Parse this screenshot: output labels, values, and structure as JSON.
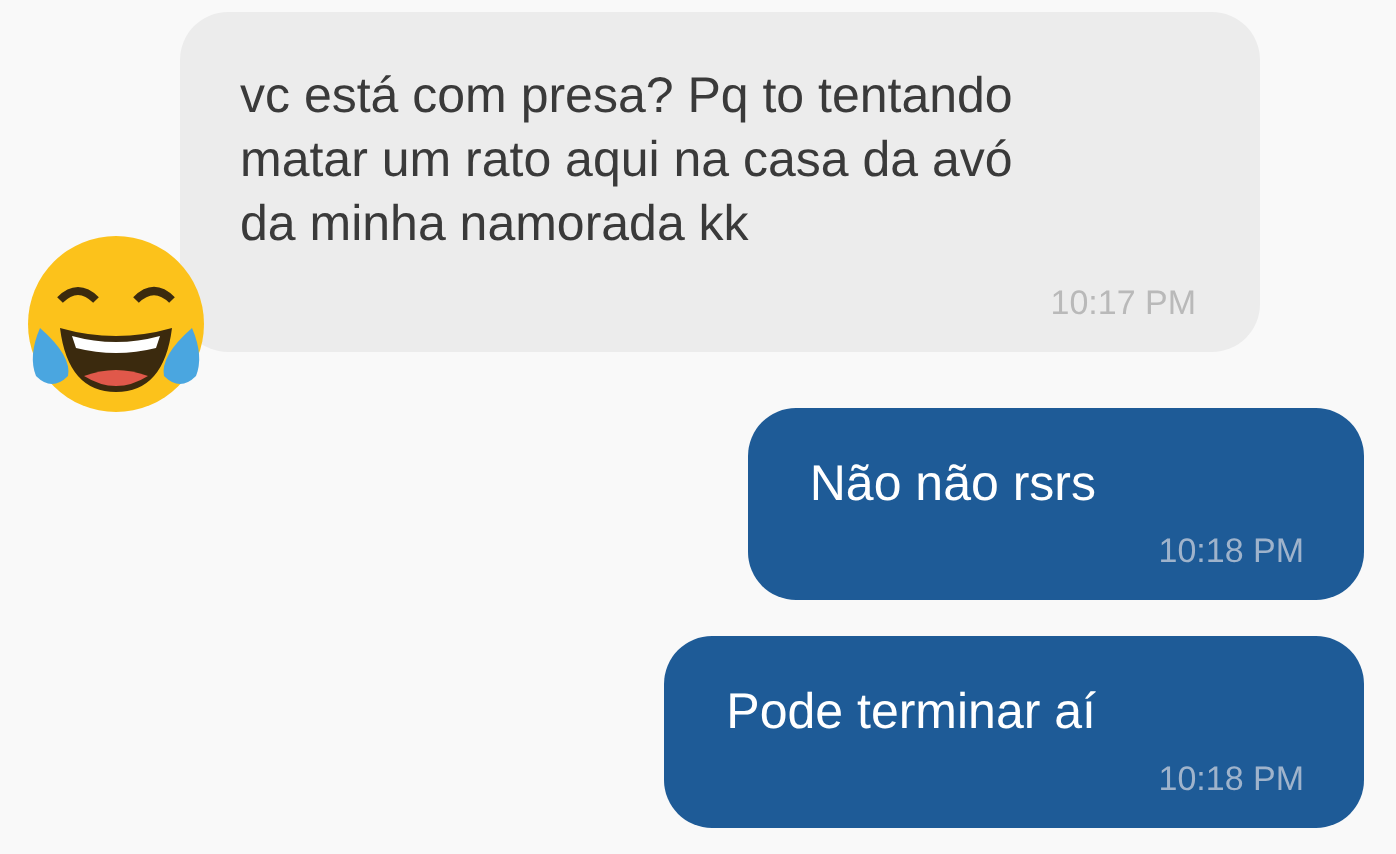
{
  "messages": [
    {
      "kind": "incoming",
      "avatar": true,
      "text": "vc está com presa? Pq to tentando\nmatar um rato aqui na casa da avó\nda minha namorada kk",
      "time": "10:17 PM"
    },
    {
      "kind": "outgoing",
      "avatar": false,
      "text": "Não não rsrs",
      "time": "10:18 PM"
    },
    {
      "kind": "outgoing",
      "avatar": false,
      "text": "Pode terminar aí",
      "time": "10:18 PM"
    }
  ]
}
